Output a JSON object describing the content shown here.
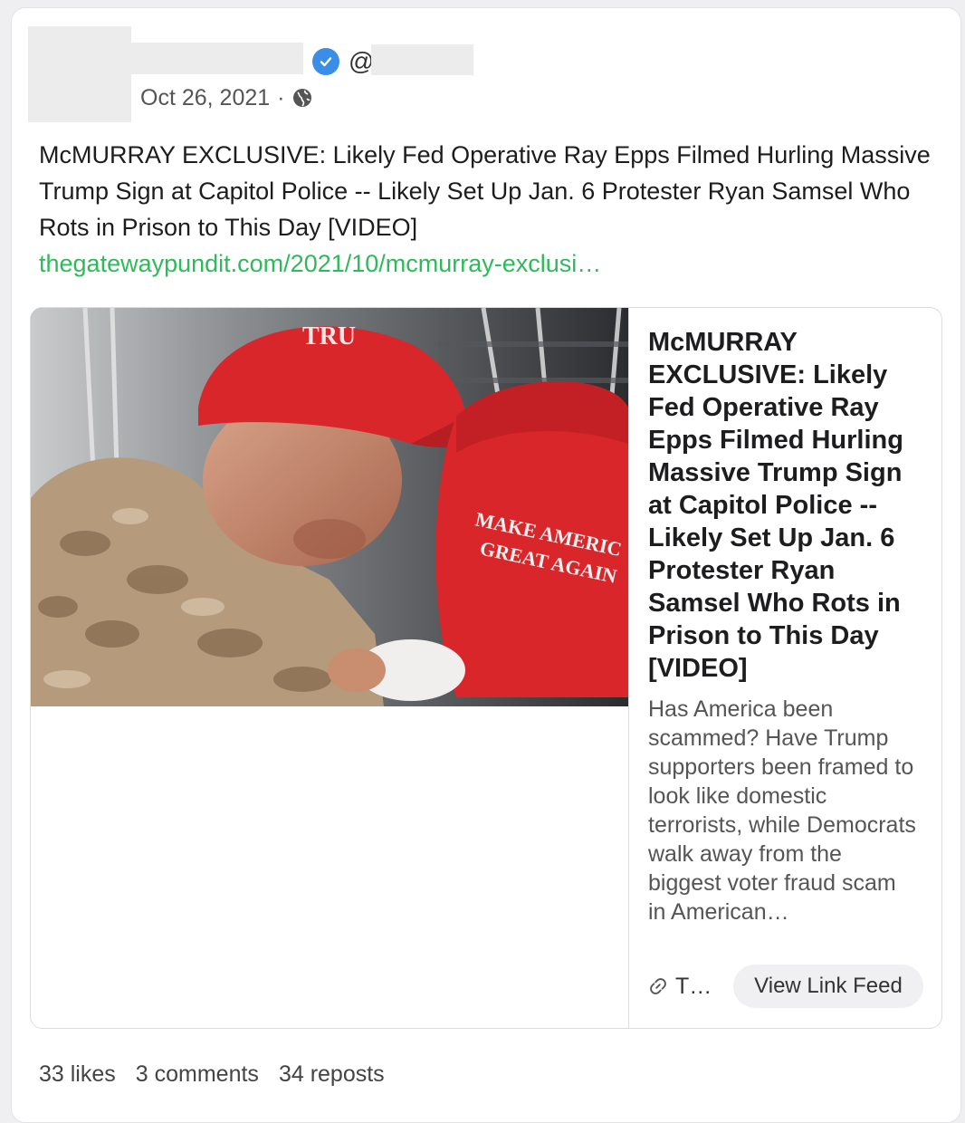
{
  "post": {
    "at_symbol": "@",
    "date": "Oct 26, 2021",
    "separator": "·",
    "visibility_icon": "globe-icon",
    "verified_icon": "verified-check-icon",
    "text": "McMURRAY EXCLUSIVE: Likely Fed Operative Ray Epps Filmed Hurling Massive Trump Sign at Capitol Police -- Likely Set Up Jan. 6 Protester Ryan Samsel Who Rots in Prison to This Day [VIDEO]",
    "link": "thegatewaypundit.com/2021/10/mcmurray-exclusi…"
  },
  "preview": {
    "title": "McMURRAY EXCLUSIVE: Likely Fed Operative Ray Epps Filmed Hurling Massive Trump Sign at Capitol Police -- Likely Set Up Jan. 6 Protester Ryan Samsel Who Rots in Prison to This Day [VIDEO]",
    "description": "Has America been scammed?  Have Trump supporters been framed to look like domestic terrorists, while Democrats walk away from the biggest voter fraud scam in American…",
    "source": "T…",
    "view_button": "View Link Feed",
    "image_hat_text_1": "TRU",
    "image_hat_text_2": "MAKE AMERIC",
    "image_hat_text_3": "GREAT AGAIN"
  },
  "stats": {
    "likes": "33 likes",
    "comments": "3 comments",
    "reposts": "34 reposts"
  },
  "colors": {
    "link": "#2dbb5a",
    "verified": "#3a8ee8",
    "hat_red": "#d8262a"
  }
}
